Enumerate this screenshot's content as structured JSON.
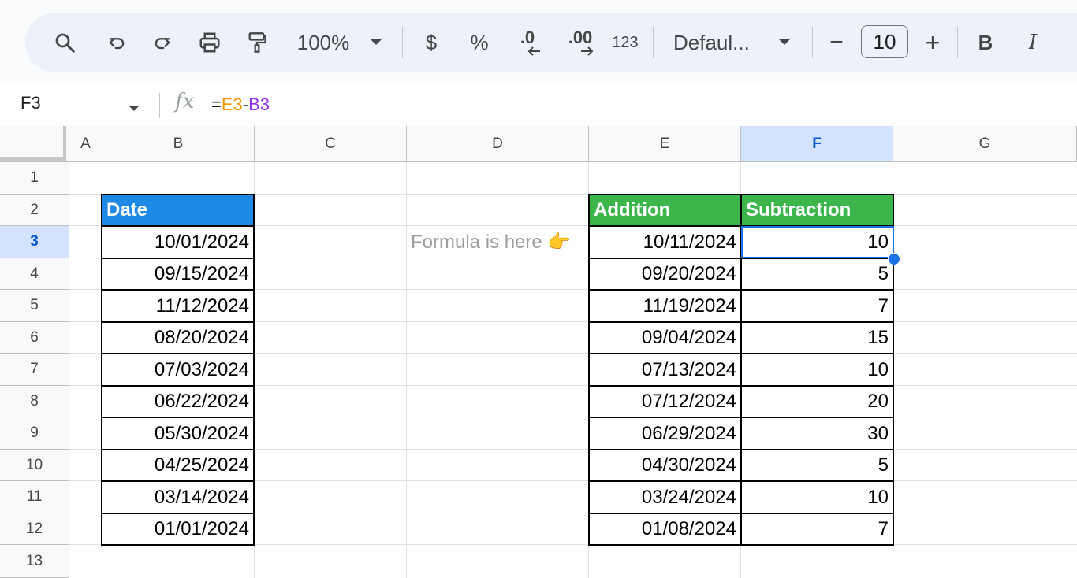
{
  "toolbar": {
    "zoom": "100%",
    "currency": "$",
    "percent": "%",
    "decrease_decimal": ".0",
    "increase_decimal": ".00",
    "number_format": "123",
    "font": "Defaul...",
    "font_size": "10",
    "minus": "−",
    "plus": "+",
    "bold": "B",
    "italic": "I"
  },
  "formula_bar": {
    "cell_ref": "F3",
    "fx": "fx",
    "formula_eq": "=",
    "formula_ref1": "E3",
    "formula_op": "-",
    "formula_ref2": "B3"
  },
  "columns": [
    "A",
    "B",
    "C",
    "D",
    "E",
    "F",
    "G"
  ],
  "rows": [
    "1",
    "2",
    "3",
    "4",
    "5",
    "6",
    "7",
    "8",
    "9",
    "10",
    "11",
    "12",
    "13"
  ],
  "table_date": {
    "header": "Date",
    "values": [
      "10/01/2024",
      "09/15/2024",
      "11/12/2024",
      "08/20/2024",
      "07/03/2024",
      "06/22/2024",
      "05/30/2024",
      "04/25/2024",
      "03/14/2024",
      "01/01/2024"
    ]
  },
  "note": "Formula is here 👉",
  "table_calc": {
    "header_addition": "Addition",
    "header_subtraction": "Subtraction",
    "addition": [
      "10/11/2024",
      "09/20/2024",
      "11/19/2024",
      "09/04/2024",
      "07/13/2024",
      "07/12/2024",
      "06/29/2024",
      "04/30/2024",
      "03/24/2024",
      "01/08/2024"
    ],
    "subtraction": [
      "10",
      "5",
      "7",
      "15",
      "10",
      "20",
      "30",
      "5",
      "10",
      "7"
    ]
  },
  "colors": {
    "header_blue": "#1e88e5",
    "header_green": "#3cb54a",
    "selection": "#1a73e8"
  }
}
